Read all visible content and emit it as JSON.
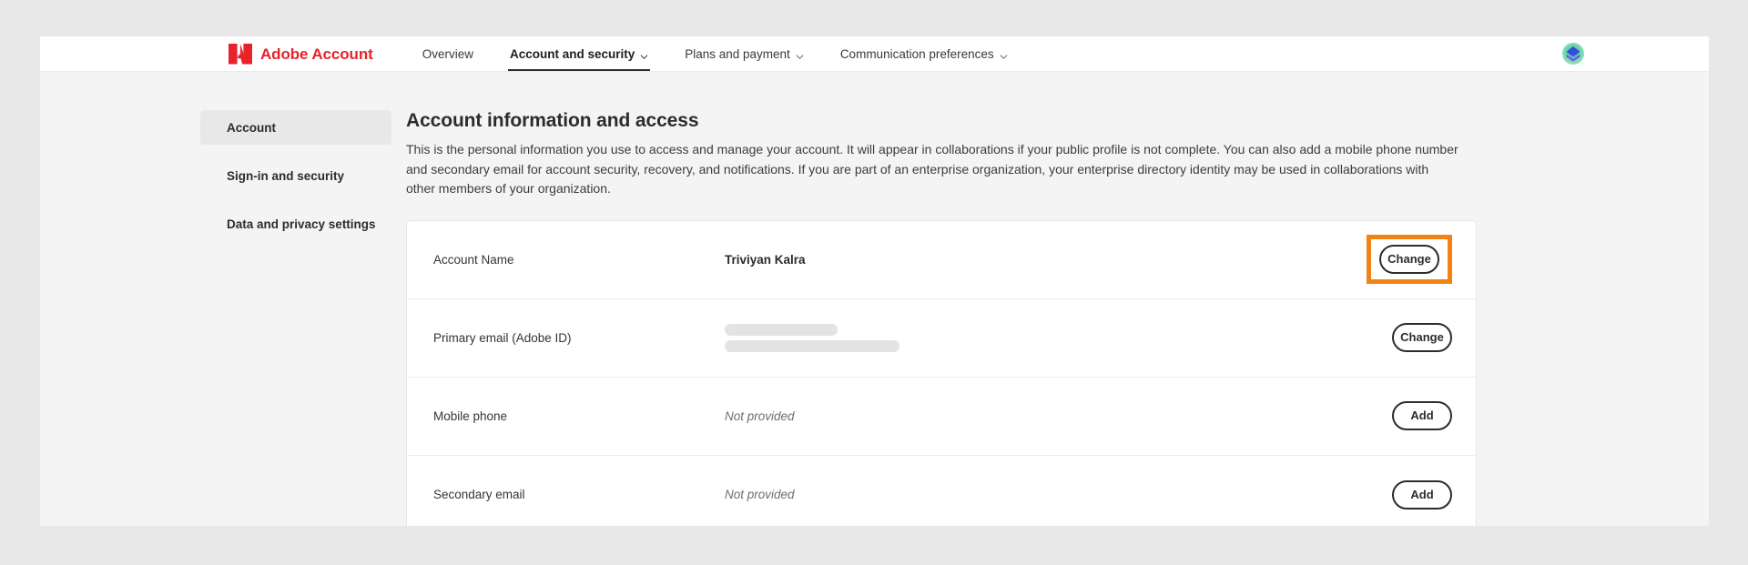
{
  "brand": {
    "name": "Adobe Account",
    "logo_icon": "adobe-logo-icon",
    "accent_color": "#e8222a"
  },
  "topnav": {
    "items": [
      {
        "label": "Overview",
        "has_chevron": false,
        "active": false
      },
      {
        "label": "Account and security",
        "has_chevron": true,
        "active": true
      },
      {
        "label": "Plans and payment",
        "has_chevron": true,
        "active": false
      },
      {
        "label": "Communication preferences",
        "has_chevron": true,
        "active": false
      }
    ],
    "avatar_icon": "user-avatar-icon"
  },
  "sidebar": {
    "items": [
      {
        "label": "Account",
        "selected": true
      },
      {
        "label": "Sign-in and security",
        "selected": false
      },
      {
        "label": "Data and privacy settings",
        "selected": false
      }
    ]
  },
  "main": {
    "title": "Account information and access",
    "description": "This is the personal information you use to access and manage your account. It will appear in collaborations if your public profile is not complete. You can also add a mobile phone number and secondary email for account security, recovery, and notifications. If you are part of an enterprise organization, your enterprise directory identity may be used in collaborations with other members of your organization."
  },
  "table": {
    "rows": [
      {
        "label": "Account Name",
        "value": "Triviyan Kalra",
        "value_kind": "text",
        "action_label": "Change",
        "highlighted": true
      },
      {
        "label": "Primary email (Adobe ID)",
        "value": "",
        "value_kind": "redacted",
        "redacted_bars": [
          124,
          192
        ],
        "action_label": "Change",
        "highlighted": false
      },
      {
        "label": "Mobile phone",
        "value": "Not provided",
        "value_kind": "muted",
        "action_label": "Add",
        "highlighted": false
      },
      {
        "label": "Secondary email",
        "value": "Not provided",
        "value_kind": "muted",
        "action_label": "Add",
        "highlighted": false
      }
    ]
  },
  "colors": {
    "highlight": "#f08313",
    "page_background": "#e8e8e8",
    "content_background": "#f4f4f4",
    "card_background": "#ffffff"
  }
}
